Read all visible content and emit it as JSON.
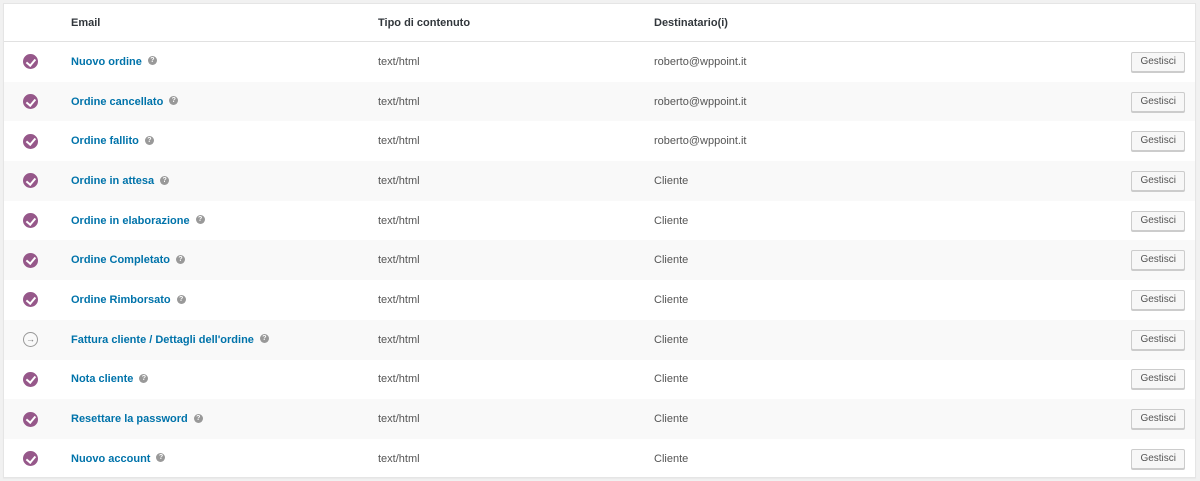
{
  "header": {
    "email": "Email",
    "content_type": "Tipo di contenuto",
    "recipients": "Destinatario(i)"
  },
  "colors": {
    "enabled_status": "#96588a",
    "link": "#0073aa"
  },
  "rows": [
    {
      "status": "enabled",
      "status_icon": "check-circle-icon",
      "name": "Nuovo ordine",
      "type": "text/html",
      "recipient": "roberto@wppoint.it",
      "button": "Gestisci"
    },
    {
      "status": "enabled",
      "status_icon": "check-circle-icon",
      "name": "Ordine cancellato",
      "type": "text/html",
      "recipient": "roberto@wppoint.it",
      "button": "Gestisci"
    },
    {
      "status": "enabled",
      "status_icon": "check-circle-icon",
      "name": "Ordine fallito",
      "type": "text/html",
      "recipient": "roberto@wppoint.it",
      "button": "Gestisci"
    },
    {
      "status": "enabled",
      "status_icon": "check-circle-icon",
      "name": "Ordine in attesa",
      "type": "text/html",
      "recipient": "Cliente",
      "button": "Gestisci"
    },
    {
      "status": "enabled",
      "status_icon": "check-circle-icon",
      "name": "Ordine in elaborazione",
      "type": "text/html",
      "recipient": "Cliente",
      "button": "Gestisci"
    },
    {
      "status": "enabled",
      "status_icon": "check-circle-icon",
      "name": "Ordine Completato",
      "type": "text/html",
      "recipient": "Cliente",
      "button": "Gestisci"
    },
    {
      "status": "enabled",
      "status_icon": "check-circle-icon",
      "name": "Ordine Rimborsato",
      "type": "text/html",
      "recipient": "Cliente",
      "button": "Gestisci"
    },
    {
      "status": "manual",
      "status_icon": "manual-arrow-circle-icon",
      "name": "Fattura cliente / Dettagli dell'ordine",
      "type": "text/html",
      "recipient": "Cliente",
      "button": "Gestisci"
    },
    {
      "status": "enabled",
      "status_icon": "check-circle-icon",
      "name": "Nota cliente",
      "type": "text/html",
      "recipient": "Cliente",
      "button": "Gestisci"
    },
    {
      "status": "enabled",
      "status_icon": "check-circle-icon",
      "name": "Resettare la password",
      "type": "text/html",
      "recipient": "Cliente",
      "button": "Gestisci"
    },
    {
      "status": "enabled",
      "status_icon": "check-circle-icon",
      "name": "Nuovo account",
      "type": "text/html",
      "recipient": "Cliente",
      "button": "Gestisci"
    }
  ]
}
